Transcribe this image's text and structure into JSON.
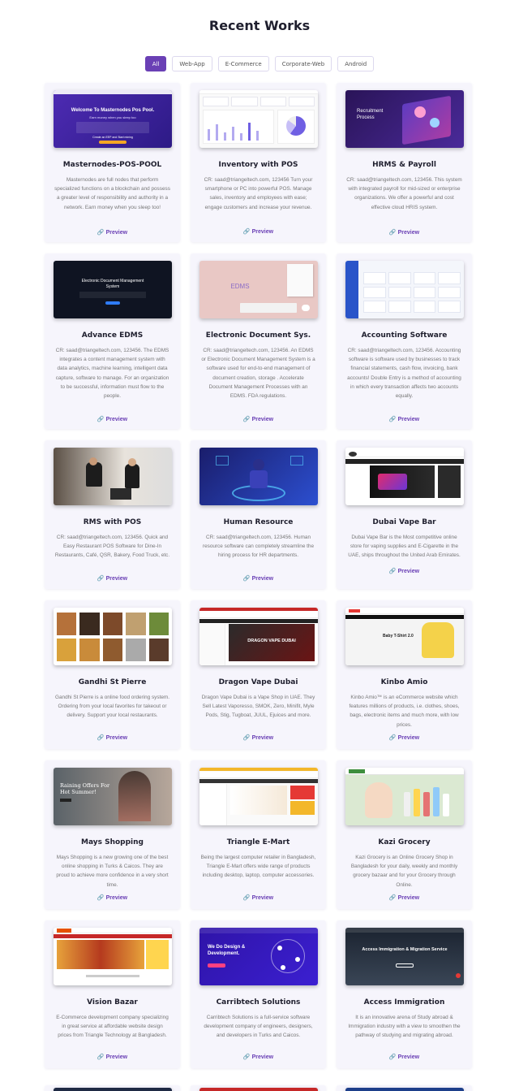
{
  "section": {
    "title": "Recent Works"
  },
  "filters": [
    {
      "label": "All",
      "active": true
    },
    {
      "label": "Web-App",
      "active": false
    },
    {
      "label": "E-Commerce",
      "active": false
    },
    {
      "label": "Corporate-Web",
      "active": false
    },
    {
      "label": "Android",
      "active": false
    }
  ],
  "preview_label": "Preview",
  "colors": {
    "accent": "#6a40b5",
    "card_bg": "#f6f5fc",
    "title": "#1f1f2e"
  },
  "projects": [
    {
      "title": "Masternodes-POS-POOL",
      "desc": "Masternodes are full nodes that perform specialized functions on a blockchain and possess a greater level of responsibility and authority in a network. Earn money when you sleep too!",
      "thumb": {
        "heading": "Welcome To Masternodes Pos Pool.",
        "sub": "Earn money when you sleep too",
        "button": "Create an EEP and Start mining"
      }
    },
    {
      "title": "Inventory with POS",
      "desc": "CR: saad@triangeltech.com, 123456 Turn your smartphone or PC into powerful POS. Manage sales, inventory and employees with ease; engage customers and increase your revenue."
    },
    {
      "title": "HRMS & Payroll",
      "desc": "CR: saad@triangeltech.com, 123456. This system with integrated payroll for mid-sized or enterprise organizations. We offer a powerful and cost effective cloud HRIS system.",
      "thumb": {
        "heading": "Recruitment Process"
      }
    },
    {
      "title": "Advance EDMS",
      "desc": "CR: saad@triangeltech.com, 123456. The EDMS integrates a content management system with data analytics, machine learning, intelligent data capture, software to manage. For an organization to be successful, information must flow to the people.",
      "thumb": {
        "heading": "Electronic Document Management System"
      }
    },
    {
      "title": "Electronic Document Sys.",
      "desc": "CR: saad@triangeltech.com, 123456. An EDMS or Electronic Document Management System is a software used for end-to-end management of document creation, storage . Accelerate Document Management Processes with an EDMS. FDA regulations.",
      "thumb": {
        "heading": "EDMS"
      }
    },
    {
      "title": "Accounting Software",
      "desc": "CR: saad@triangeltech.com, 123456. Accounting software is software used by businesses to track financial statements, cash flow, invoicing, bank accounts! Double Entry is a method of accounting in which every transaction affects two accounts equally."
    },
    {
      "title": "RMS with POS",
      "desc": "CR: saad@triangeltech.com, 123456. Quick and Easy Restaurant POS Software for Dine-In Restaurants, Café, QSR, Bakery, Food Truck, etc."
    },
    {
      "title": "Human Resource",
      "desc": "CR: saad@triangeltech.com, 123456. Human resource software can completely streamline the hiring process for HR departments."
    },
    {
      "title": "Dubai Vape Bar",
      "desc": "Dubai Vape Bar is the Most competitive online store for vaping supplies and E-Cigarette in the UAE, ships throughout the United Arab Emirates."
    },
    {
      "title": "Gandhi St Pierre",
      "desc": "Gandhi St Pierre is a online food ordering system. Ordering from your local favorites for takeout or delivery. Support your local restaurants."
    },
    {
      "title": "Dragon Vape Dubai",
      "desc": "Dragon Vape Dubai is a Vape Shop in UAE. They Sell Latest Vaporesso, SMOK, Zero, Minifit, Myle Pods, Stig, Tugboat, JUUL, Ejuices and more.",
      "thumb": {
        "heading": "DRAGON VAPE DUBAI"
      }
    },
    {
      "title": "Kinbo Amio",
      "desc": "Kinbo Amio™ is an eCommerce website which features millions of products, i.e. clothes, shoes, bags, electronic items and much more, with low prices.",
      "thumb": {
        "heading": "Baby T-Shirt 2.0"
      }
    },
    {
      "title": "Mays Shopping",
      "desc": "Mays Shopping is a new growing one of the best online shopping in Turks & Caicos. They are proud to achieve more confidence in a very short time.",
      "thumb": {
        "heading": "Raining Offers For Hot Summer!"
      }
    },
    {
      "title": "Triangle E-Mart",
      "desc": "Being the largest computer retailer in Bangladesh, Triangle E-Mart offers wide range of products including desktop, laptop, computer accessories."
    },
    {
      "title": "Kazi Grocery",
      "desc": "Kazi Grocery is an Online Grocery Shop in Bangladesh for your daily, weekly and monthly grocery bazaar and for your Grocery through Online."
    },
    {
      "title": "Vision Bazar",
      "desc": "E-Commerce development company specializing in great service at affordable website design prices from Triangle Technology at Bangladesh."
    },
    {
      "title": "Carribtech Solutions",
      "desc": "Carribtech Solutions is a full-service software development company of engineers, designers, and developers in Turks and Caicos.",
      "thumb": {
        "heading": "We Do Design & Development."
      }
    },
    {
      "title": "Access Immigration",
      "desc": "It is an innovative arena of Study abroad & Immigration industry with a view to smoothen the pathway of studying and migrating abroad.",
      "thumb": {
        "heading": "Access Immigration & Migration Service"
      }
    }
  ]
}
